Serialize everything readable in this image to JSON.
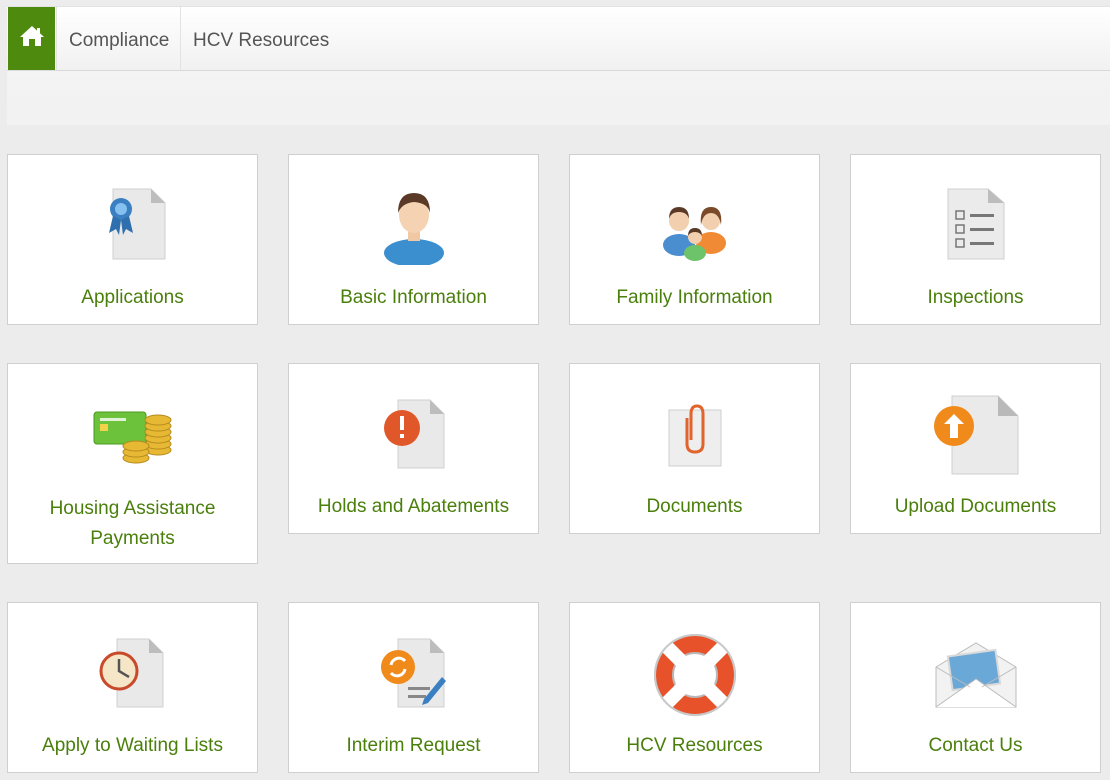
{
  "nav": {
    "home_icon": "home-icon",
    "links": [
      {
        "label": "Compliance"
      },
      {
        "label": "HCV Resources"
      }
    ]
  },
  "tiles": [
    {
      "label": "Applications",
      "icon": "ribbon-document-icon"
    },
    {
      "label": "Basic Information",
      "icon": "person-icon"
    },
    {
      "label": "Family Information",
      "icon": "family-icon"
    },
    {
      "label": "Inspections",
      "icon": "checklist-document-icon"
    },
    {
      "label": "Housing Assistance Payments",
      "icon": "credit-card-coins-icon"
    },
    {
      "label": "Holds and Abatements",
      "icon": "alert-document-icon"
    },
    {
      "label": "Documents",
      "icon": "paperclip-document-icon"
    },
    {
      "label": "Upload Documents",
      "icon": "upload-document-icon"
    },
    {
      "label": "Apply to Waiting Lists",
      "icon": "clock-document-icon"
    },
    {
      "label": "Interim Request",
      "icon": "refresh-edit-document-icon"
    },
    {
      "label": "HCV Resources",
      "icon": "lifebuoy-icon"
    },
    {
      "label": "Contact Us",
      "icon": "envelope-icon"
    }
  ],
  "colors": {
    "accent_green": "#4e8a0e",
    "label_green": "#4a7f0c",
    "alert_orange": "#e8642c"
  }
}
